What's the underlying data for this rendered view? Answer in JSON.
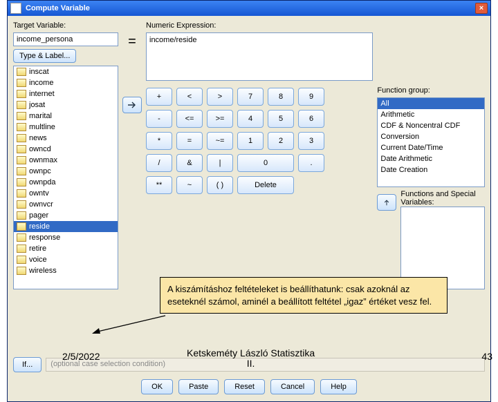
{
  "title": "Compute Variable",
  "labels": {
    "target": "Target Variable:",
    "numeric": "Numeric Expression:",
    "typeLabel": "Type & Label...",
    "fg": "Function group:",
    "fsv": "Functions and Special Variables:",
    "condtxt": "(optional case selection condition)"
  },
  "target_value": "income_persona",
  "expression": "income/reside",
  "equals": "=",
  "varlist": [
    "inscat",
    "income",
    "internet",
    "josat",
    "marital",
    "multline",
    "news",
    "owncd",
    "ownmax",
    "ownpc",
    "ownpda",
    "owntv",
    "ownvcr",
    "pager",
    "reside",
    "response",
    "retire",
    "voice",
    "wireless"
  ],
  "var_selected": "reside",
  "keypad": [
    [
      "+",
      "<",
      ">",
      "7",
      "8",
      "9"
    ],
    [
      "-",
      "<=",
      ">=",
      "4",
      "5",
      "6"
    ],
    [
      "*",
      "=",
      "~=",
      "1",
      "2",
      "3"
    ],
    [
      "/",
      "&",
      "|",
      "",
      "0",
      "."
    ],
    [
      "**",
      "~",
      "( )",
      "Delete",
      "",
      ""
    ]
  ],
  "fg_items": [
    "All",
    "Arithmetic",
    "CDF & Noncentral CDF",
    "Conversion",
    "Current Date/Time",
    "Date Arithmetic",
    "Date Creation"
  ],
  "fg_selected": "All",
  "ifbtn": "If...",
  "buttons": {
    "ok": "OK",
    "paste": "Paste",
    "reset": "Reset",
    "cancel": "Cancel",
    "help": "Help"
  },
  "annotation": "A kiszámításhoz feltételeket is beállíthatunk: csak azoknál az eseteknél számol, aminél a beállított feltétel „igaz” értéket vesz fel.",
  "footer": {
    "date": "2/5/2022",
    "center": "Ketskeméty László Statisztika\nII.",
    "page": "43"
  }
}
